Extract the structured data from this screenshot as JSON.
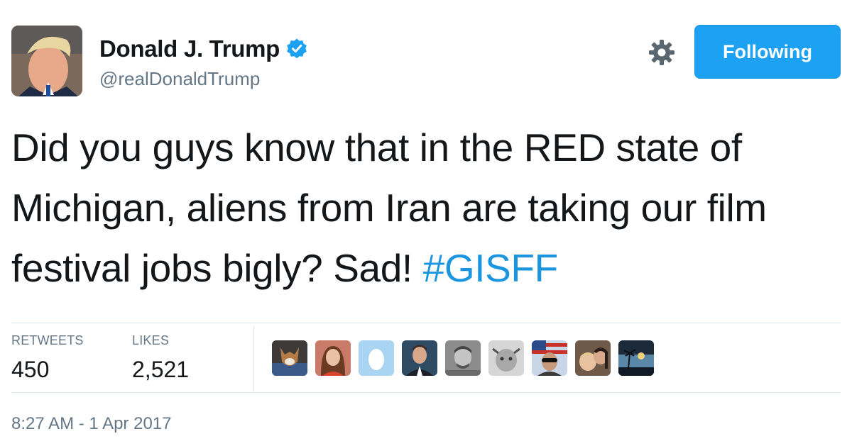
{
  "profile": {
    "name": "Donald J. Trump",
    "handle": "@realDonaldTrump",
    "follow_label": "Following"
  },
  "tweet": {
    "text": "Did you guys know that in the RED state of Michigan, aliens from Iran are taking our film festival jobs bigly? Sad! ",
    "hashtag": "#GISFF",
    "timestamp": "8:27 AM - 1 Apr 2017"
  },
  "stats": {
    "retweets_label": "RETWEETS",
    "retweets_value": "450",
    "likes_label": "LIKES",
    "likes_value": "2,521"
  },
  "colors": {
    "accent": "#1da1f2",
    "hashtag": "#1b95e0",
    "muted_text": "#657786",
    "divider": "#e1e8ed"
  },
  "icons": {
    "settings": "gear-icon",
    "verified": "verified-badge-icon"
  }
}
